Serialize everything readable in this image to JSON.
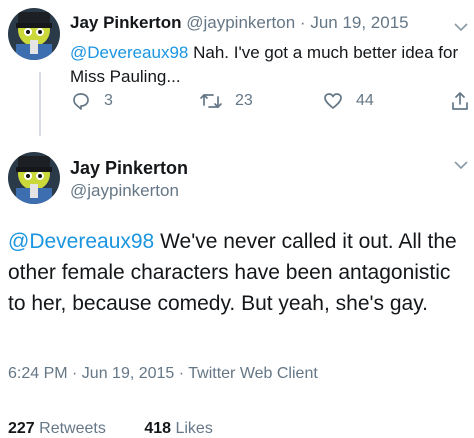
{
  "reply_tweet": {
    "author_name": "Jay Pinkerton",
    "author_handle": "@jaypinkerton",
    "separator": "·",
    "date": "Jun 19, 2015",
    "mention": "@Devereaux98",
    "text": " Nah. I've got a much better idea for Miss Pauling...",
    "actions": {
      "reply": {
        "icon": "reply-icon",
        "count": "3"
      },
      "retweet": {
        "icon": "retweet-icon",
        "count": "23"
      },
      "like": {
        "icon": "heart-icon",
        "count": "44"
      },
      "share": {
        "icon": "share-icon"
      }
    }
  },
  "main_tweet": {
    "author_name": "Jay Pinkerton",
    "author_handle": "@jaypinkerton",
    "mention": "@Devereaux98",
    "text": " We've never called it out. All the other female characters have been antagonistic to her, because comedy. But yeah, she's gay.",
    "timestamp": "6:24 PM · Jun 19, 2015 · Twitter Web Client"
  },
  "stats": {
    "retweets_count": "227",
    "retweets_label": "Retweets",
    "likes_count": "418",
    "likes_label": "Likes"
  },
  "colors": {
    "link": "#1b95e0",
    "muted": "#657786",
    "text": "#14171a"
  }
}
